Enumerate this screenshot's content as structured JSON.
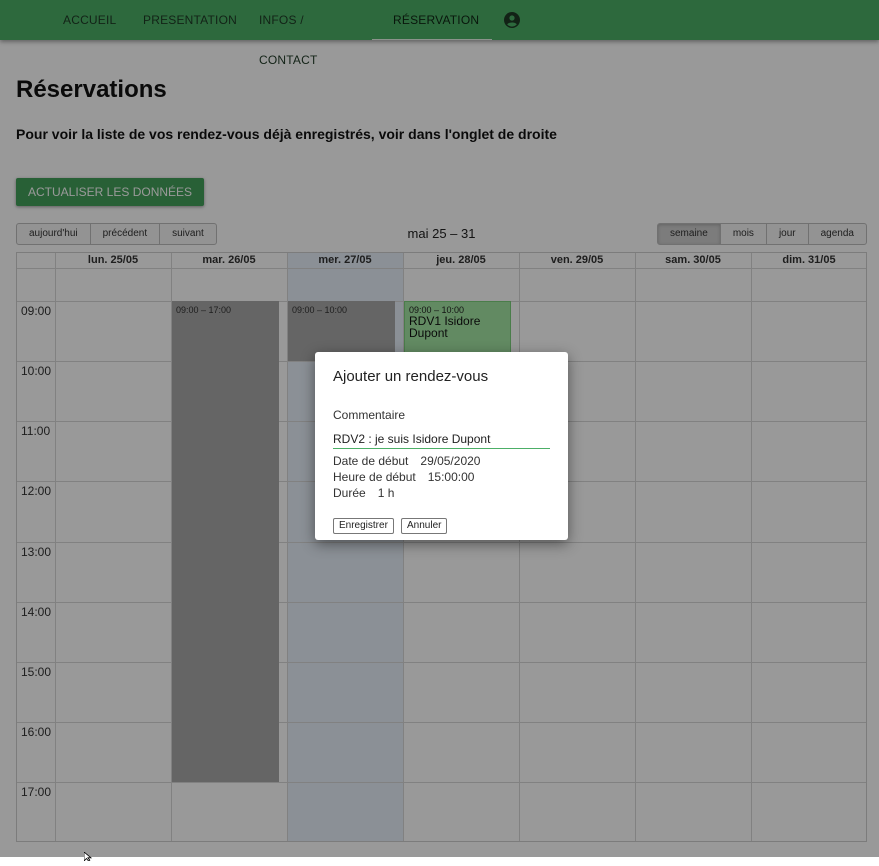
{
  "navbar": {
    "items": [
      {
        "label": "ACCUEIL"
      },
      {
        "label": "PRESENTATION"
      },
      {
        "label": "INFOS / CONTACT"
      },
      {
        "label": "RÉSERVATION"
      }
    ],
    "account_icon": "account-circle-icon",
    "bg_color": "#4caf67"
  },
  "page": {
    "title": "Réservations",
    "info": "Pour voir la liste de vos rendez-vous déjà enregistrés, voir dans l'onglet de droite",
    "refresh_label": "ACTUALISER LES DONNÉES"
  },
  "calendar": {
    "title": "mai 25 – 31",
    "nav_buttons": [
      "aujourd'hui",
      "précédent",
      "suivant"
    ],
    "view_buttons": [
      "semaine",
      "mois",
      "jour",
      "agenda"
    ],
    "active_view": "semaine",
    "days": [
      "lun. 25/05",
      "mar. 26/05",
      "mer. 27/05",
      "jeu. 28/05",
      "ven. 29/05",
      "sam. 30/05",
      "dim. 31/05"
    ],
    "today": "mer. 27/05",
    "hours": [
      "09:00",
      "10:00",
      "11:00",
      "12:00",
      "13:00",
      "14:00",
      "15:00",
      "16:00",
      "17:00"
    ],
    "events": [
      {
        "day": "mar. 26/05",
        "time": "09:00 – 17:00",
        "title": ""
      },
      {
        "day": "mer. 27/05",
        "time": "09:00 – 10:00",
        "title": ""
      },
      {
        "day": "jeu. 28/05",
        "time": "09:00 – 10:00",
        "title": "RDV1 Isidore Dupont"
      }
    ]
  },
  "dialog": {
    "title": "Ajouter un rendez-vous",
    "comment_label": "Commentaire",
    "comment_value": "RDV2 : je suis Isidore Dupont",
    "date_label": "Date de début",
    "date_value": "29/05/2020",
    "time_label": "Heure de début",
    "time_value": "15:00:00",
    "duration_label": "Durée",
    "duration_value": "1 h",
    "save_label": "Enregistrer",
    "cancel_label": "Annuler"
  }
}
